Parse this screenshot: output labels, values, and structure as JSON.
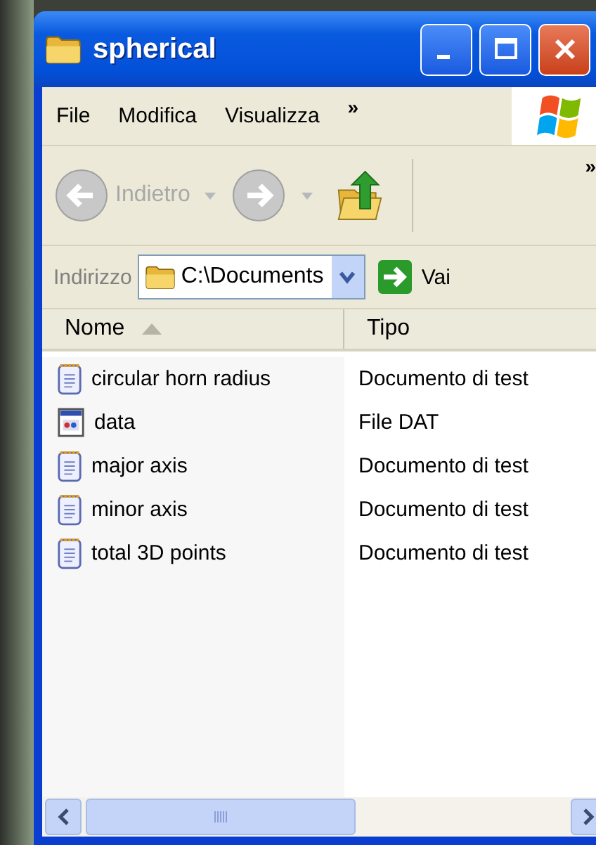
{
  "window": {
    "title": "spherical"
  },
  "menu": [
    "File",
    "Modifica",
    "Visualizza",
    "»"
  ],
  "toolbar": {
    "back": {
      "label": "Indietro",
      "disabled": true
    },
    "forward": {
      "disabled": true
    },
    "overflow": "»"
  },
  "address": {
    "label": "Indirizzo",
    "value": "C:\\Documents",
    "go": "Vai"
  },
  "columns": [
    {
      "label": "Nome",
      "sorted": true
    },
    {
      "label": "Tipo",
      "sorted": false
    }
  ],
  "files": [
    {
      "name": "circular horn radius",
      "type": "Documento di test",
      "kind": "text"
    },
    {
      "name": "data",
      "type": "File DAT",
      "kind": "dat"
    },
    {
      "name": "major axis",
      "type": "Documento di test",
      "kind": "text"
    },
    {
      "name": "minor axis",
      "type": "Documento di test",
      "kind": "text"
    },
    {
      "name": "total 3D points",
      "type": "Documento di test",
      "kind": "text"
    }
  ]
}
